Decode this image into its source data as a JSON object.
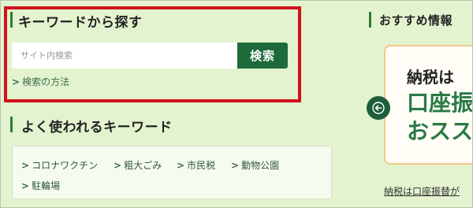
{
  "search_section": {
    "heading": "キーワードから探す",
    "placeholder": "サイト内検索",
    "button_label": "検索",
    "help_link": "検索の方法"
  },
  "keywords_section": {
    "heading": "よく使われるキーワード",
    "items": [
      "コロナワクチン",
      "粗大ごみ",
      "市民税",
      "動物公園",
      "駐輪場"
    ]
  },
  "recommend_section": {
    "heading": "おすすめ情報",
    "card_lines": [
      "納税は",
      "口座振",
      "おスス"
    ],
    "caption": "納税は口座振替が"
  },
  "colors": {
    "background": "#e3f3cf",
    "accent_green": "#1e6a3b",
    "highlight_red": "#d0121b",
    "card_border": "#f3c88b"
  },
  "icons": {
    "chevron": "chevron-right-icon",
    "carousel_prev": "arrow-left-icon"
  }
}
